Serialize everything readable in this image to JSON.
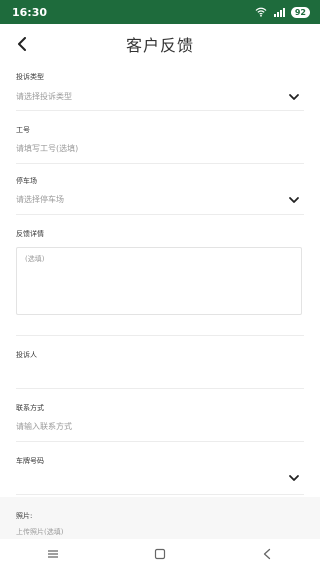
{
  "status_bar": {
    "time": "16:30",
    "battery": "92"
  },
  "header": {
    "title": "客户反馈"
  },
  "form": {
    "complaint_type": {
      "label": "投诉类型",
      "placeholder": "请选择投诉类型"
    },
    "employee_id": {
      "label": "工号",
      "placeholder": "请填写工号(选填)"
    },
    "parking_lot": {
      "label": "停车场",
      "placeholder": "请选择停车场"
    },
    "details": {
      "label": "反馈详情",
      "placeholder": "(选填)"
    },
    "complainant": {
      "label": "投诉人",
      "value": ""
    },
    "contact": {
      "label": "联系方式",
      "placeholder": "请输入联系方式"
    },
    "plate": {
      "label": "车牌号码",
      "value": ""
    },
    "photos": {
      "label": "照片:",
      "hint": "上传照片(选填)"
    }
  },
  "icons": {
    "back": "chevron-left-icon",
    "dropdown": "chevron-down-icon",
    "nav_menu": "menu-icon",
    "nav_home": "square-icon",
    "nav_back": "triangle-left-icon"
  },
  "colors": {
    "status_bar": "#1e6b3c"
  }
}
